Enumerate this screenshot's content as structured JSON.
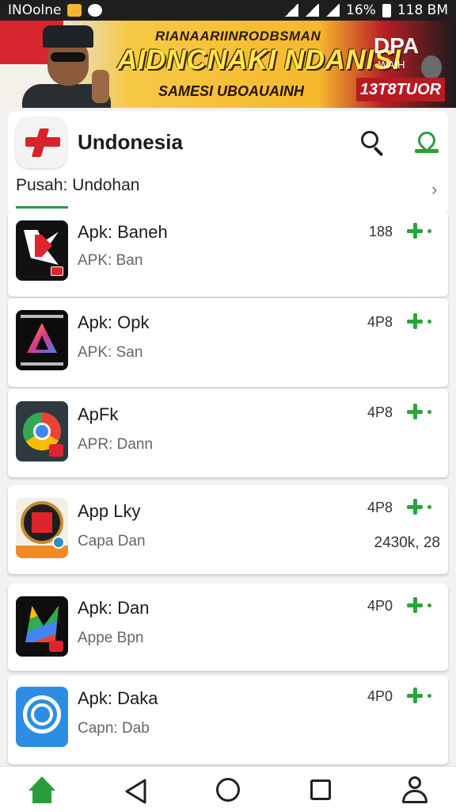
{
  "status_bar": {
    "carrier": "INOolne",
    "battery": "16%",
    "time": "118 BM"
  },
  "banner": {
    "line1": "RIANAARIINRODBSMAN",
    "line2": "AIDNCNAKI NDANISI",
    "line3": "SAMESI UBOAUAINH",
    "right_top": "DPA",
    "right_mid": "WAIH",
    "right_date": "13T8TUOR"
  },
  "header": {
    "title": "Undonesia",
    "breadcrumb": "Pusah: Undohan",
    "chevron": "›"
  },
  "apps": [
    {
      "name": "Apk: Baneh",
      "sub": "APK: Ban",
      "size": "188",
      "extra": ""
    },
    {
      "name": "Apk: Opk",
      "sub": "APK: San",
      "size": "4P8",
      "extra": ""
    },
    {
      "name": "ApFk",
      "sub": "APR: Dann",
      "size": "4P8",
      "extra": ""
    },
    {
      "name": "App Lky",
      "sub": "Capa Dan",
      "size": "4P8",
      "extra": "2430k, 28"
    },
    {
      "name": "Apk: Dan",
      "sub": "Appe Bpn",
      "size": "4P0",
      "extra": ""
    },
    {
      "name": "Apk: Daka",
      "sub": "Capn: Dab",
      "size": "4P0",
      "extra": ""
    }
  ],
  "icons": {
    "search": "search-icon",
    "map": "map-pin-icon",
    "home": "home-icon",
    "back": "back-icon",
    "circle": "home-circle-icon",
    "square": "recents-icon",
    "profile": "profile-icon",
    "add": "add-icon"
  },
  "colors": {
    "accent": "#2a9d3a",
    "brand_red": "#d8232a"
  }
}
